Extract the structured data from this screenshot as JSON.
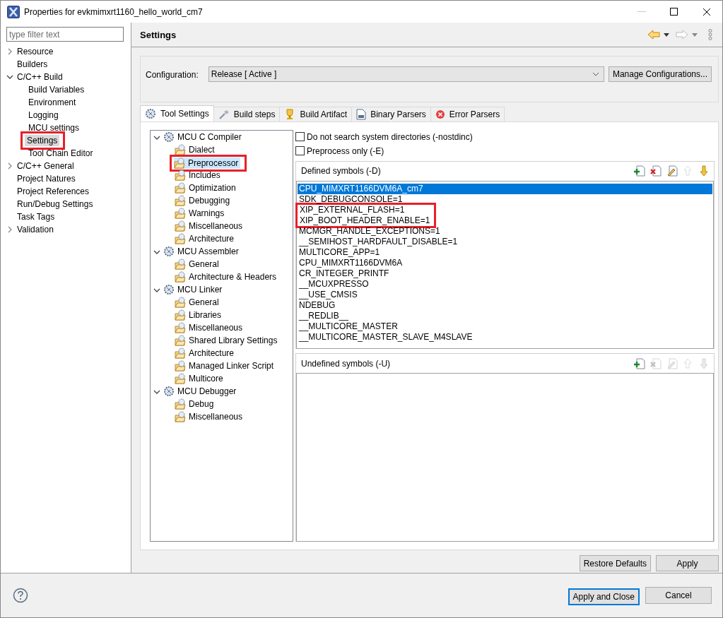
{
  "window": {
    "title": "Properties for evkmimxrt1160_hello_world_cm7"
  },
  "filter": {
    "placeholder": "type filter text"
  },
  "nav": [
    {
      "label": "Resource",
      "expanded": false,
      "selected": false
    },
    {
      "label": "Builders",
      "selected": false
    },
    {
      "label": "C/C++ Build",
      "expanded": true,
      "selected": false,
      "children": [
        {
          "label": "Build Variables",
          "selected": false
        },
        {
          "label": "Environment",
          "selected": false
        },
        {
          "label": "Logging",
          "selected": false
        },
        {
          "label": "MCU settings",
          "selected": false
        },
        {
          "label": "Settings",
          "selected": true,
          "highlighted": true
        },
        {
          "label": "Tool Chain Editor",
          "selected": false
        }
      ]
    },
    {
      "label": "C/C++ General",
      "expanded": false,
      "selected": false
    },
    {
      "label": "Project Natures",
      "selected": false
    },
    {
      "label": "Project References",
      "selected": false
    },
    {
      "label": "Run/Debug Settings",
      "selected": false
    },
    {
      "label": "Task Tags",
      "selected": false
    },
    {
      "label": "Validation",
      "expanded": false,
      "selected": false
    }
  ],
  "page_title": "Settings",
  "configuration": {
    "label": "Configuration:",
    "value": "Release  [ Active ]",
    "button": "Manage Configurations..."
  },
  "tabs": [
    {
      "label": "Tool Settings",
      "kind": "gear",
      "selected": true
    },
    {
      "label": "Build steps",
      "kind": "hammer",
      "selected": false
    },
    {
      "label": "Build Artifact",
      "kind": "trophy",
      "selected": false
    },
    {
      "label": "Binary Parsers",
      "kind": "binary",
      "selected": false
    },
    {
      "label": "Error Parsers",
      "kind": "error",
      "selected": false
    }
  ],
  "tool_tree": [
    {
      "label": "MCU C Compiler",
      "expanded": true,
      "selected": false,
      "children": [
        {
          "label": "Dialect",
          "selected": false
        },
        {
          "label": "Preprocessor",
          "selected": true,
          "highlighted": true
        },
        {
          "label": "Includes",
          "selected": false
        },
        {
          "label": "Optimization",
          "selected": false
        },
        {
          "label": "Debugging",
          "selected": false
        },
        {
          "label": "Warnings",
          "selected": false
        },
        {
          "label": "Miscellaneous",
          "selected": false
        },
        {
          "label": "Architecture",
          "selected": false
        }
      ]
    },
    {
      "label": "MCU Assembler",
      "expanded": true,
      "selected": false,
      "children": [
        {
          "label": "General",
          "selected": false
        },
        {
          "label": "Architecture & Headers",
          "selected": false
        }
      ]
    },
    {
      "label": "MCU Linker",
      "expanded": true,
      "selected": false,
      "children": [
        {
          "label": "General",
          "selected": false
        },
        {
          "label": "Libraries",
          "selected": false
        },
        {
          "label": "Miscellaneous",
          "selected": false
        },
        {
          "label": "Shared Library Settings",
          "selected": false
        },
        {
          "label": "Architecture",
          "selected": false
        },
        {
          "label": "Managed Linker Script",
          "selected": false
        },
        {
          "label": "Multicore",
          "selected": false
        }
      ]
    },
    {
      "label": "MCU Debugger",
      "expanded": true,
      "selected": false,
      "children": [
        {
          "label": "Debug",
          "selected": false
        },
        {
          "label": "Miscellaneous",
          "selected": false
        }
      ]
    }
  ],
  "options": [
    {
      "label": "Do not search system directories (-nostdinc)",
      "checked": false
    },
    {
      "label": "Preprocess only (-E)",
      "checked": false
    }
  ],
  "defined_symbols": {
    "title": "Defined symbols (-D)",
    "tools": [
      {
        "kind": "add",
        "disabled": false
      },
      {
        "kind": "delete",
        "disabled": false
      },
      {
        "kind": "edit",
        "disabled": false
      },
      {
        "kind": "up",
        "disabled": true
      },
      {
        "kind": "down",
        "disabled": false
      }
    ],
    "items": [
      {
        "text": "CPU_MIMXRT1166DVM6A_cm7",
        "selected": true,
        "highlighted": false
      },
      {
        "text": "SDK_DEBUGCONSOLE=1",
        "selected": false,
        "highlighted": false
      },
      {
        "text": "XIP_EXTERNAL_FLASH=1",
        "selected": false,
        "highlighted": true
      },
      {
        "text": "XIP_BOOT_HEADER_ENABLE=1",
        "selected": false,
        "highlighted": true
      },
      {
        "text": "MCMGR_HANDLE_EXCEPTIONS=1",
        "selected": false,
        "highlighted": false
      },
      {
        "text": "__SEMIHOST_HARDFAULT_DISABLE=1",
        "selected": false,
        "highlighted": false
      },
      {
        "text": "MULTICORE_APP=1",
        "selected": false,
        "highlighted": false
      },
      {
        "text": "CPU_MIMXRT1166DVM6A",
        "selected": false,
        "highlighted": false
      },
      {
        "text": "CR_INTEGER_PRINTF",
        "selected": false,
        "highlighted": false
      },
      {
        "text": "__MCUXPRESSO",
        "selected": false,
        "highlighted": false
      },
      {
        "text": "__USE_CMSIS",
        "selected": false,
        "highlighted": false
      },
      {
        "text": "NDEBUG",
        "selected": false,
        "highlighted": false
      },
      {
        "text": "__REDLIB__",
        "selected": false,
        "highlighted": false
      },
      {
        "text": "__MULTICORE_MASTER",
        "selected": false,
        "highlighted": false
      },
      {
        "text": "__MULTICORE_MASTER_SLAVE_M4SLAVE",
        "selected": false,
        "highlighted": false
      }
    ]
  },
  "undefined_symbols": {
    "title": "Undefined symbols (-U)",
    "tools": [
      {
        "kind": "add",
        "disabled": false
      },
      {
        "kind": "delete",
        "disabled": true
      },
      {
        "kind": "edit",
        "disabled": true
      },
      {
        "kind": "up",
        "disabled": true
      },
      {
        "kind": "down",
        "disabled": true
      }
    ]
  },
  "page_buttons": [
    "Restore Defaults",
    "Apply"
  ],
  "dialog_buttons": [
    {
      "label": "Apply and Close",
      "default": true
    },
    {
      "label": "Cancel",
      "default": false
    }
  ]
}
